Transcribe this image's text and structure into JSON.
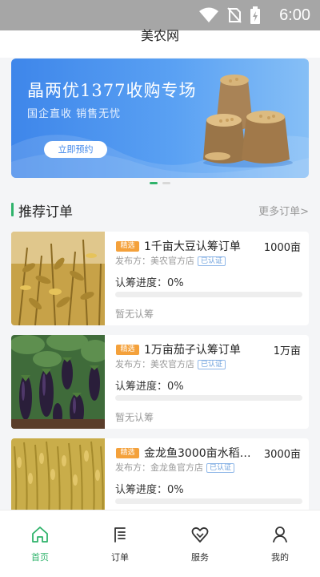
{
  "status_bar": {
    "time": "6:00"
  },
  "app": {
    "title": "美农网"
  },
  "banner": {
    "title": "晶两优1377收购专场",
    "subtitle": "国企直收   销售无忧",
    "button_label": "立即预约",
    "slide_count": 2,
    "active_slide": 1
  },
  "section": {
    "title": "推荐订单",
    "more_label": "更多订单>"
  },
  "orders": [
    {
      "tag": "精选",
      "title": "1千亩大豆认筹订单",
      "qty": "1000亩",
      "publisher": "发布方：美农官方店",
      "badge": "已认证",
      "progress_label": "认筹进度：0%",
      "progress": 0,
      "empty_text": "暂无认筹",
      "image": "soybean"
    },
    {
      "tag": "精选",
      "title": "1万亩茄子认筹订单",
      "qty": "1万亩",
      "publisher": "发布方：美农官方店",
      "badge": "已认证",
      "progress_label": "认筹进度：0%",
      "progress": 0,
      "empty_text": "暂无认筹",
      "image": "eggplant"
    },
    {
      "tag": "精选",
      "title": "金龙鱼3000亩水稻…",
      "qty": "3000亩",
      "publisher": "发布方：金龙鱼官方店",
      "badge": "已认证",
      "progress_label": "认筹进度：0%",
      "progress": 0,
      "empty_text": "",
      "image": "rice"
    }
  ],
  "tabs": [
    {
      "label": "首页",
      "icon": "home-icon",
      "active": true
    },
    {
      "label": "订单",
      "icon": "order-list-icon",
      "active": false
    },
    {
      "label": "服务",
      "icon": "service-heart-icon",
      "active": false
    },
    {
      "label": "我的",
      "icon": "user-icon",
      "active": false
    }
  ],
  "colors": {
    "accent": "#2fb36b",
    "banner_blue": "#3e86ea",
    "tag_orange": "#f4a13b"
  }
}
